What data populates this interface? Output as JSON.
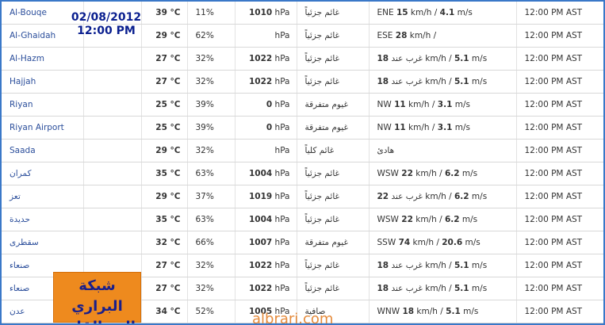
{
  "stamp": {
    "date": "02/08/2012",
    "time": "12:00 PM"
  },
  "logo": {
    "line1": "شبكة البراري",
    "line2": "المد القادم"
  },
  "watermark": "albrari.com",
  "rows": [
    {
      "city": "Al-Bouqe",
      "temp": "39 °C",
      "humidity": "11%",
      "pressure": "1010",
      "pressure_unit": "hPa",
      "condition": "غائم جزئياً",
      "wind_dir": "ENE",
      "wind_kmh": "15",
      "wind_ms": "4.1",
      "time": "12:00 PM AST"
    },
    {
      "city": "Al-Ghaidah",
      "temp": "29 °C",
      "humidity": "62%",
      "pressure": "",
      "pressure_unit": "hPa",
      "condition": "غائم جزئياً",
      "wind_dir": "ESE",
      "wind_kmh": "28",
      "wind_ms": "",
      "time": "12:00 PM AST"
    },
    {
      "city": "Al-Hazm",
      "temp": "27 °C",
      "humidity": "32%",
      "pressure": "1022",
      "pressure_unit": "hPa",
      "condition": "غائم جزئياً",
      "wind_dir": "غرب عند",
      "wind_kmh": "18",
      "wind_ms": "5.1",
      "time": "12:00 PM AST"
    },
    {
      "city": "Hajjah",
      "temp": "27 °C",
      "humidity": "32%",
      "pressure": "1022",
      "pressure_unit": "hPa",
      "condition": "غائم جزئياً",
      "wind_dir": "غرب عند",
      "wind_kmh": "18",
      "wind_ms": "5.1",
      "time": "12:00 PM AST"
    },
    {
      "city": "Riyan",
      "temp": "25 °C",
      "humidity": "39%",
      "pressure": "0",
      "pressure_unit": "hPa",
      "condition": "غيوم متفرقة",
      "wind_dir": "NW",
      "wind_kmh": "11",
      "wind_ms": "3.1",
      "time": "12:00 PM AST"
    },
    {
      "city": "Riyan Airport",
      "temp": "25 °C",
      "humidity": "39%",
      "pressure": "0",
      "pressure_unit": "hPa",
      "condition": "غيوم متفرقة",
      "wind_dir": "NW",
      "wind_kmh": "11",
      "wind_ms": "3.1",
      "time": "12:00 PM AST"
    },
    {
      "city": "Saada",
      "temp": "29 °C",
      "humidity": "32%",
      "pressure": "",
      "pressure_unit": "hPa",
      "condition": "غائم كلياً",
      "wind_calm": "هادئ",
      "time": "12:00 PM AST"
    },
    {
      "city": "كمران",
      "temp": "35 °C",
      "humidity": "63%",
      "pressure": "1004",
      "pressure_unit": "hPa",
      "condition": "غائم جزئياً",
      "wind_dir": "WSW",
      "wind_kmh": "22",
      "wind_ms": "6.2",
      "time": "12:00 PM AST"
    },
    {
      "city": "تعز",
      "temp": "29 °C",
      "humidity": "37%",
      "pressure": "1019",
      "pressure_unit": "hPa",
      "condition": "غائم جزئياً",
      "wind_dir": "غرب عند",
      "wind_kmh": "22",
      "wind_ms": "6.2",
      "time": "12:00 PM AST"
    },
    {
      "city": "حديدة",
      "temp": "35 °C",
      "humidity": "63%",
      "pressure": "1004",
      "pressure_unit": "hPa",
      "condition": "غائم جزئياً",
      "wind_dir": "WSW",
      "wind_kmh": "22",
      "wind_ms": "6.2",
      "time": "12:00 PM AST"
    },
    {
      "city": "سقطرى",
      "temp": "32 °C",
      "humidity": "66%",
      "pressure": "1007",
      "pressure_unit": "hPa",
      "condition": "غيوم متفرقة",
      "wind_dir": "SSW",
      "wind_kmh": "74",
      "wind_ms": "20.6",
      "time": "12:00 PM AST"
    },
    {
      "city": "صنعاء",
      "temp": "27 °C",
      "humidity": "32%",
      "pressure": "1022",
      "pressure_unit": "hPa",
      "condition": "غائم جزئياً",
      "wind_dir": "غرب عند",
      "wind_kmh": "18",
      "wind_ms": "5.1",
      "time": "12:00 PM AST"
    },
    {
      "city": "صنعاء",
      "temp": "27 °C",
      "humidity": "32%",
      "pressure": "1022",
      "pressure_unit": "hPa",
      "condition": "غائم جزئياً",
      "wind_dir": "غرب عند",
      "wind_kmh": "18",
      "wind_ms": "5.1",
      "time": "12:00 PM AST"
    },
    {
      "city": "عدن",
      "temp": "34 °C",
      "humidity": "52%",
      "pressure": "1005",
      "pressure_unit": "hPa",
      "condition": "صافية",
      "wind_dir": "WNW",
      "wind_kmh": "18",
      "wind_ms": "5.1",
      "time": "12:00 PM AST"
    }
  ]
}
